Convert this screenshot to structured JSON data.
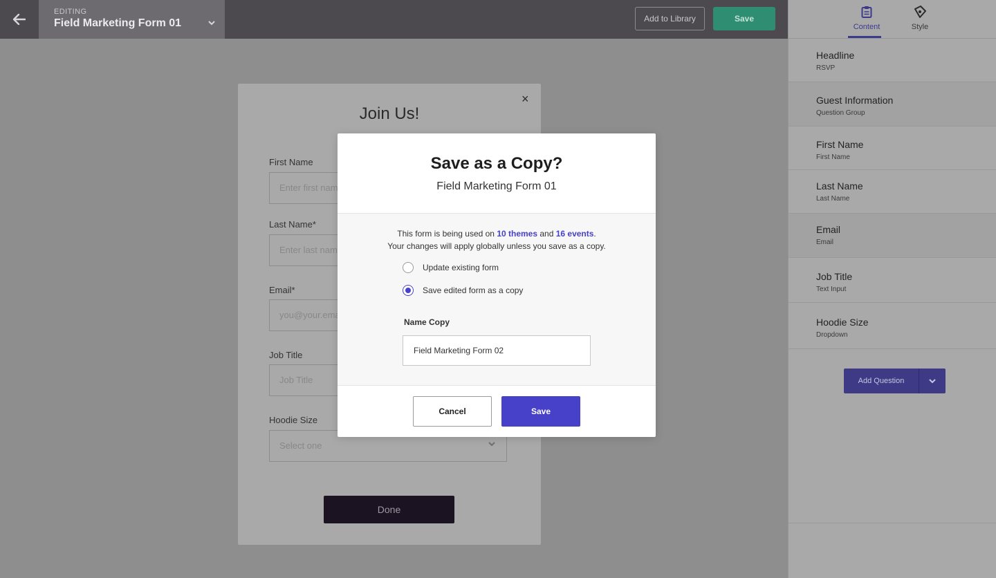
{
  "topbar": {
    "editing_label": "EDITING",
    "form_name": "Field Marketing Form 01",
    "add_to_library_label": "Add to Library",
    "save_label": "Save"
  },
  "form_preview": {
    "title": "Join Us!",
    "close_glyph": "×",
    "fields": [
      {
        "label": "First Name",
        "placeholder": "Enter first name"
      },
      {
        "label": "Last Name*",
        "placeholder": "Enter last name"
      },
      {
        "label": "Email*",
        "placeholder": "you@your.email"
      },
      {
        "label": "Job Title",
        "placeholder": "Job Title"
      },
      {
        "label": "Hoodie Size",
        "placeholder": "Select one"
      }
    ],
    "done_label": "Done"
  },
  "panel": {
    "tabs": [
      {
        "label": "Content",
        "icon": "clipboard-icon",
        "active": true
      },
      {
        "label": "Style",
        "icon": "style-icon",
        "active": false
      }
    ],
    "items": [
      {
        "title": "Headline",
        "subtitle": "RSVP"
      },
      {
        "title": "Guest Information",
        "subtitle": "Question Group"
      },
      {
        "title": "First Name",
        "subtitle": "First Name"
      },
      {
        "title": "Last Name",
        "subtitle": "Last Name"
      },
      {
        "title": "Email",
        "subtitle": "Email"
      },
      {
        "title": "Job Title",
        "subtitle": "Text Input"
      },
      {
        "title": "Hoodie Size",
        "subtitle": "Dropdown"
      }
    ],
    "add_question_label": "Add Question"
  },
  "modal": {
    "title": "Save as a Copy?",
    "subtitle": "Field Marketing Form 01",
    "message_prefix": "This form is being used on ",
    "themes_link": "10 themes",
    "message_and": " and ",
    "events_link": "16 events",
    "message_period": ".",
    "message_line2": "Your changes will apply globally unless you save as a copy.",
    "options": [
      {
        "label": "Update existing form",
        "checked": false
      },
      {
        "label": "Save edited form as a copy",
        "checked": true
      }
    ],
    "name_copy_label": "Name Copy",
    "name_copy_value": "Field Marketing Form 02",
    "cancel_label": "Cancel",
    "save_label": "Save"
  },
  "colors": {
    "accent": "#4741c9",
    "topbar_save": "#2f8d71",
    "topbar_bg": "#4d4a4f"
  }
}
